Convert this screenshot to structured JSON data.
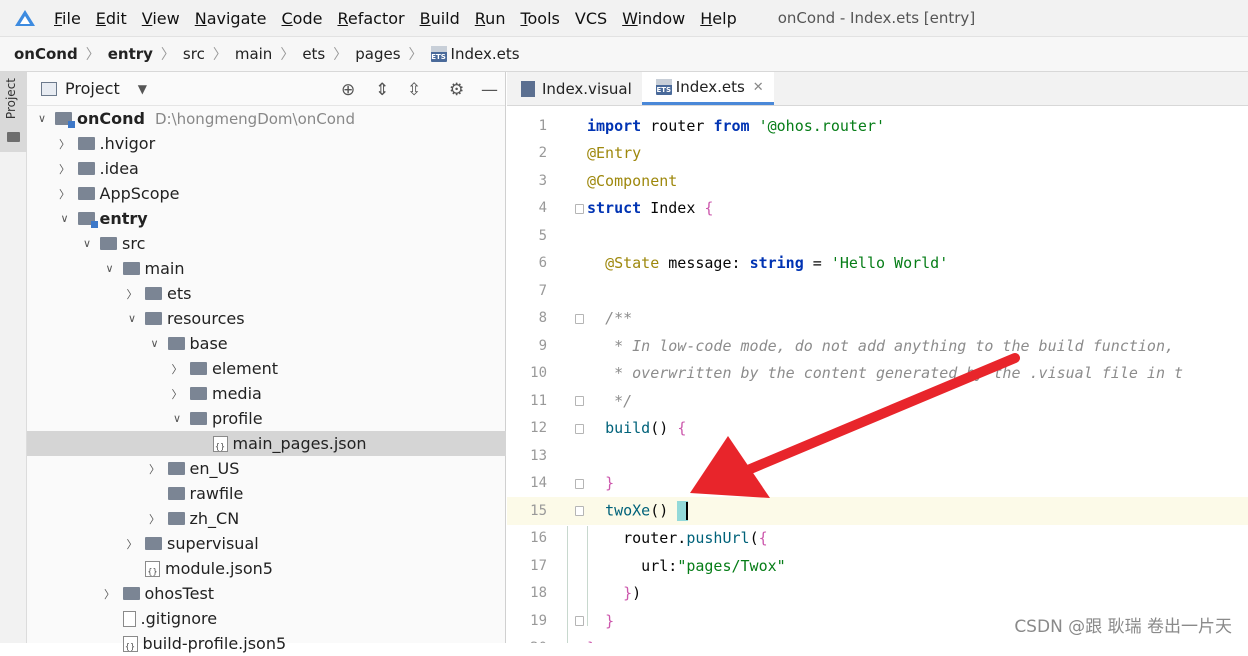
{
  "menubar": {
    "items": [
      "File",
      "Edit",
      "View",
      "Navigate",
      "Code",
      "Refactor",
      "Build",
      "Run",
      "Tools",
      "VCS",
      "Window",
      "Help"
    ],
    "mnemonics": [
      "F",
      "E",
      "V",
      "N",
      "C",
      "R",
      "B",
      "R",
      "T",
      "",
      "W",
      "H"
    ],
    "window_title": "onCond - Index.ets [entry]"
  },
  "breadcrumb": {
    "items": [
      "onCond",
      "entry",
      "src",
      "main",
      "ets",
      "pages",
      "Index.ets"
    ]
  },
  "side_strip": {
    "label": "Project"
  },
  "project_panel": {
    "title": "Project",
    "tree": [
      {
        "label": "onCond",
        "path": "D:\\hongmengDom\\onCond",
        "depth": 0,
        "expanded": true,
        "type": "module",
        "bold": true
      },
      {
        "label": ".hvigor",
        "depth": 1,
        "expanded": false,
        "type": "folder"
      },
      {
        "label": ".idea",
        "depth": 1,
        "expanded": false,
        "type": "folder"
      },
      {
        "label": "AppScope",
        "depth": 1,
        "expanded": false,
        "type": "folder"
      },
      {
        "label": "entry",
        "depth": 1,
        "expanded": true,
        "type": "module",
        "bold": true
      },
      {
        "label": "src",
        "depth": 2,
        "expanded": true,
        "type": "folder"
      },
      {
        "label": "main",
        "depth": 3,
        "expanded": true,
        "type": "folder"
      },
      {
        "label": "ets",
        "depth": 4,
        "expanded": false,
        "type": "folder"
      },
      {
        "label": "resources",
        "depth": 4,
        "expanded": true,
        "type": "folder"
      },
      {
        "label": "base",
        "depth": 5,
        "expanded": true,
        "type": "folder"
      },
      {
        "label": "element",
        "depth": 6,
        "expanded": false,
        "type": "folder"
      },
      {
        "label": "media",
        "depth": 6,
        "expanded": false,
        "type": "folder"
      },
      {
        "label": "profile",
        "depth": 6,
        "expanded": true,
        "type": "folder"
      },
      {
        "label": "main_pages.json",
        "depth": 7,
        "type": "json",
        "selected": true
      },
      {
        "label": "en_US",
        "depth": 5,
        "expanded": false,
        "type": "folder"
      },
      {
        "label": "rawfile",
        "depth": 5,
        "type": "folder"
      },
      {
        "label": "zh_CN",
        "depth": 5,
        "expanded": false,
        "type": "folder"
      },
      {
        "label": "supervisual",
        "depth": 4,
        "expanded": false,
        "type": "folder"
      },
      {
        "label": "module.json5",
        "depth": 4,
        "type": "json"
      },
      {
        "label": "ohosTest",
        "depth": 3,
        "expanded": false,
        "type": "folder"
      },
      {
        "label": ".gitignore",
        "depth": 3,
        "type": "file"
      },
      {
        "label": "build-profile.json5",
        "depth": 3,
        "type": "json"
      }
    ]
  },
  "editor": {
    "tabs": [
      {
        "label": "Index.visual",
        "active": false
      },
      {
        "label": "Index.ets",
        "active": true
      }
    ],
    "current_line": 15,
    "lines": [
      {
        "n": "1",
        "tokens": [
          [
            "kw",
            "import"
          ],
          [
            "plain",
            " router "
          ],
          [
            "kw",
            "from"
          ],
          [
            "plain",
            " "
          ],
          [
            "str",
            "'@ohos.router'"
          ]
        ]
      },
      {
        "n": "2",
        "tokens": [
          [
            "ann",
            "@Entry"
          ]
        ]
      },
      {
        "n": "3",
        "tokens": [
          [
            "ann",
            "@Component"
          ]
        ]
      },
      {
        "n": "4",
        "tokens": [
          [
            "kw",
            "struct"
          ],
          [
            "plain",
            " Index "
          ],
          [
            "brace",
            "{"
          ]
        ]
      },
      {
        "n": "5",
        "tokens": []
      },
      {
        "n": "6",
        "tokens": [
          [
            "plain",
            "  "
          ],
          [
            "ann",
            "@State"
          ],
          [
            "plain",
            " message: "
          ],
          [
            "kw",
            "string"
          ],
          [
            "plain",
            " = "
          ],
          [
            "str",
            "'Hello World'"
          ]
        ]
      },
      {
        "n": "7",
        "tokens": []
      },
      {
        "n": "8",
        "tokens": [
          [
            "plain",
            "  "
          ],
          [
            "cm",
            "/**"
          ]
        ]
      },
      {
        "n": "9",
        "tokens": [
          [
            "plain",
            "   "
          ],
          [
            "cm",
            "* In low-code mode, do not add anything to the build function, "
          ]
        ]
      },
      {
        "n": "10",
        "tokens": [
          [
            "plain",
            "   "
          ],
          [
            "cm",
            "* overwritten by the content generated by the .visual file in t"
          ]
        ]
      },
      {
        "n": "11",
        "tokens": [
          [
            "plain",
            "   "
          ],
          [
            "cm",
            "*/"
          ]
        ]
      },
      {
        "n": "12",
        "tokens": [
          [
            "plain",
            "  "
          ],
          [
            "fn",
            "build"
          ],
          [
            "plain",
            "() "
          ],
          [
            "brace",
            "{"
          ]
        ]
      },
      {
        "n": "13",
        "tokens": []
      },
      {
        "n": "14",
        "tokens": [
          [
            "plain",
            "  "
          ],
          [
            "brace",
            "}"
          ]
        ]
      },
      {
        "n": "15",
        "tokens": [
          [
            "plain",
            "  "
          ],
          [
            "fn",
            "twoXe"
          ],
          [
            "plain",
            "() "
          ]
        ]
      },
      {
        "n": "16",
        "tokens": [
          [
            "plain",
            "    router."
          ],
          [
            "fn",
            "pushUrl"
          ],
          [
            "plain",
            "("
          ],
          [
            "brace",
            "{"
          ]
        ]
      },
      {
        "n": "17",
        "tokens": [
          [
            "plain",
            "      url:"
          ],
          [
            "str",
            "\"pages/Twox\""
          ]
        ]
      },
      {
        "n": "18",
        "tokens": [
          [
            "plain",
            "    "
          ],
          [
            "brace",
            "}"
          ],
          [
            "plain",
            ")"
          ]
        ]
      },
      {
        "n": "19",
        "tokens": [
          [
            "plain",
            "  "
          ],
          [
            "brace",
            "}"
          ]
        ]
      },
      {
        "n": "20",
        "tokens": [
          [
            "brace",
            "}"
          ]
        ]
      }
    ]
  },
  "watermark": "CSDN @跟 耿瑞 卷出一片天",
  "colors": {
    "accent": "#4a88d8",
    "arrow": "#e8252b",
    "current_line": "#fcfae8"
  }
}
